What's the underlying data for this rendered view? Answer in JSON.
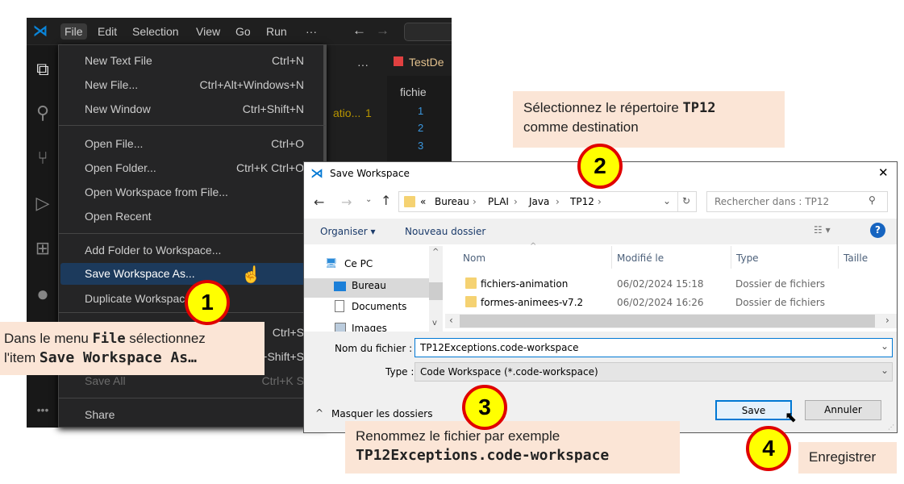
{
  "vscode": {
    "menubar": [
      "File",
      "Edit",
      "Selection",
      "View",
      "Go",
      "Run",
      "···"
    ],
    "nav": {
      "back": "←",
      "forward": "→"
    },
    "file_menu": {
      "groups": [
        [
          {
            "label": "New Text File",
            "shortcut": "Ctrl+N"
          },
          {
            "label": "New File...",
            "shortcut": "Ctrl+Alt+Windows+N"
          },
          {
            "label": "New Window",
            "shortcut": "Ctrl+Shift+N"
          }
        ],
        [
          {
            "label": "Open File...",
            "shortcut": "Ctrl+O"
          },
          {
            "label": "Open Folder...",
            "shortcut": "Ctrl+K Ctrl+O"
          },
          {
            "label": "Open Workspace from File...",
            "shortcut": ""
          },
          {
            "label": "Open Recent",
            "shortcut": ""
          }
        ],
        [
          {
            "label": "Add Folder to Workspace...",
            "shortcut": ""
          },
          {
            "label": "Save Workspace As...",
            "shortcut": "",
            "highlighted": true
          },
          {
            "label": "Duplicate Workspace",
            "shortcut": ""
          }
        ],
        [
          {
            "label": "",
            "shortcut": "Ctrl+S"
          },
          {
            "label": "",
            "shortcut": "Ctrl+Shift+S"
          },
          {
            "label": "Save All",
            "shortcut": "Ctrl+K S",
            "disabled": true
          }
        ],
        [
          {
            "label": "Share",
            "shortcut": ""
          }
        ]
      ]
    },
    "editor": {
      "more": "···",
      "tab": "TestDe",
      "breadcrumb": "fichie",
      "problem": "atio...",
      "problem_count": "1",
      "lines": [
        "1",
        "2",
        "3"
      ]
    }
  },
  "dialog": {
    "title": "Save Workspace",
    "close": "✕",
    "path": [
      "«",
      "Bureau",
      "PLAI",
      "Java",
      "TP12"
    ],
    "search_placeholder": "Rechercher dans : TP12",
    "toolbar": {
      "organize": "Organiser ▾",
      "new_folder": "Nouveau dossier",
      "help": "?"
    },
    "nav_tree": [
      "Ce PC",
      "Bureau",
      "Documents",
      "Images"
    ],
    "columns": [
      "Nom",
      "Modifié le",
      "Type",
      "Taille"
    ],
    "files": [
      {
        "name": "fichiers-animation",
        "modified": "06/02/2024 15:18",
        "type": "Dossier de fichiers"
      },
      {
        "name": "formes-animees-v7.2",
        "modified": "06/02/2024 16:26",
        "type": "Dossier de fichiers"
      }
    ],
    "filename_label": "Nom du fichier :",
    "filename_value": "TP12Exceptions.code-workspace",
    "type_label": "Type :",
    "type_value": "Code Workspace (*.code-workspace)",
    "hide_folders": "Masquer les dossiers",
    "save": "Save",
    "cancel": "Annuler"
  },
  "callouts": {
    "step1": {
      "number": "1",
      "text_a": "Dans le menu ",
      "code_a": "File",
      "text_b": " sélectionnez",
      "text_c": "l'item ",
      "code_b": "Save Workspace As…"
    },
    "step2": {
      "number": "2",
      "text_a": "Sélectionnez le répertoire ",
      "code": "TP12",
      "text_b": "comme destination"
    },
    "step3": {
      "number": "3",
      "text": "Renommez le fichier par exemple",
      "code": "TP12Exceptions.code-workspace"
    },
    "step4": {
      "number": "4",
      "text": "Enregistrer"
    }
  },
  "colors": {
    "callout_bg": "#fbe5d6",
    "circle_fill": "#ffff00",
    "circle_border": "#e00000",
    "menu_highlight": "#1c3a5c",
    "vscode_blue": "#0078d4"
  }
}
